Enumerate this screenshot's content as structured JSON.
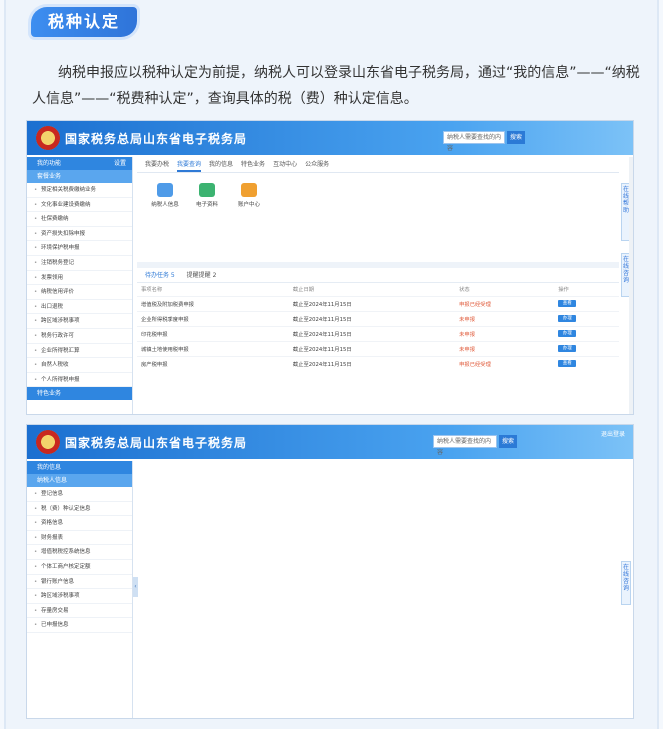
{
  "section_tag": "税种认定",
  "intro_text": "纳税申报应以税种认定为前提，纳税人可以登录山东省电子税务局，通过“我的信息”——“纳税人信息”——“税费种认定”，查询具体的税（费）种认定信息。",
  "portal_title": "国家税务总局山东省电子税务局",
  "screenshot1": {
    "search_placeholder": "纳税人需要查找的内容",
    "search_button": "搜索",
    "sidebar_head": "我的功能",
    "sidebar_head_tail": "设置",
    "sidebar_group": "套餐业务",
    "sidebar_items": [
      "预定相关税费缴纳业务",
      "文化事业建设费缴纳",
      "社保费缴纳",
      "资产损失扣除申报",
      "环境保护税申报",
      "注销税务登记",
      "发票领用",
      "纳税信用评价",
      "出口退税",
      "跨区域涉税事项",
      "税务行政许可",
      "企业所得税汇算",
      "自然人税收",
      "个人所得税申报"
    ],
    "sidebar_footer": "特色业务",
    "tabs": [
      "我要办税",
      "我要查询",
      "我的信息",
      "特色业务",
      "互动中心",
      "公众服务"
    ],
    "active_tab": "我要查询",
    "tiles": [
      {
        "label": "纳税人信息",
        "color": "#4f9be8"
      },
      {
        "label": "电子资料",
        "color": "#3cb371"
      },
      {
        "label": "账户中心",
        "color": "#f0a030"
      }
    ],
    "card_tabs": [
      "待办任务 5",
      "提醒提醒 2"
    ],
    "table_headers": [
      "事项名称",
      "截止日期",
      "状态",
      "操作"
    ],
    "rows": [
      {
        "name": "增值税及附加税费申报",
        "date": "截止至2024年11月15日",
        "status": "申报已经受理",
        "op": "查看"
      },
      {
        "name": "企业所得税季度申报",
        "date": "截止至2024年11月15日",
        "status": "未申报",
        "op": "办理"
      },
      {
        "name": "印花税申报",
        "date": "截止至2024年11月15日",
        "status": "未申报",
        "op": "办理"
      },
      {
        "name": "城镇土地使用税申报",
        "date": "截止至2024年11月15日",
        "status": "未申报",
        "op": "办理"
      },
      {
        "name": "房产税申报",
        "date": "截止至2024年11月15日",
        "status": "申报已经受理",
        "op": "查看"
      }
    ],
    "float_tab_1": "在线帮助",
    "float_tab_2": "在线咨询"
  },
  "screenshot2": {
    "login_label": "退出登录",
    "search_placeholder": "纳税人需要查找的内容",
    "search_button": "搜索",
    "sidebar_head": "我的信息",
    "sidebar_group": "纳税人信息",
    "sidebar_items": [
      "登记信息",
      "税（费）种认定信息",
      "资格信息",
      "财务报表",
      "增值税税控系统信息",
      "个体工商户核定定额",
      "银行账户信息",
      "跨区域涉税事项",
      "存量房交易",
      "已申报信息"
    ],
    "float_tab": "在线咨询"
  }
}
